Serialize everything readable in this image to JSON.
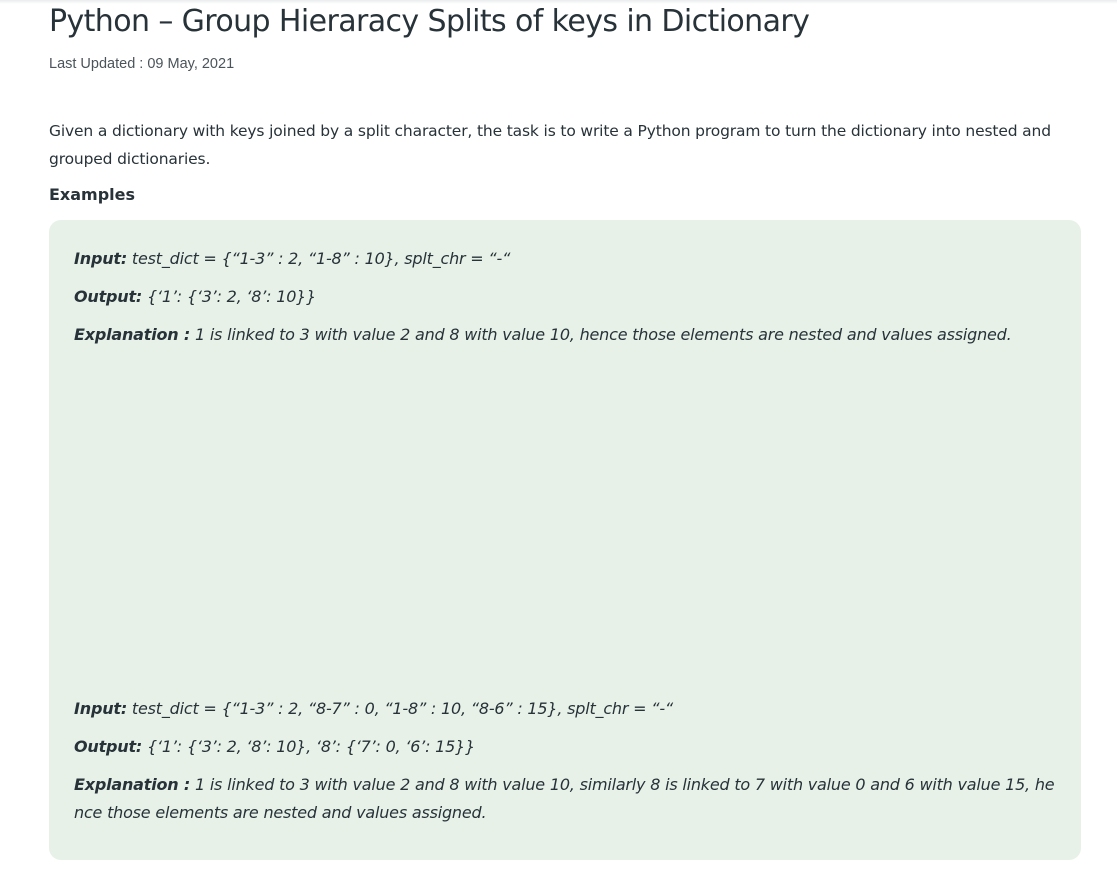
{
  "article": {
    "title": "Python – Group Hieraracy Splits of keys in Dictionary",
    "last_updated": "Last Updated : 09 May, 2021",
    "intro": "Given a dictionary with keys joined by a split character, the task is to write a Python program to turn the dictionary into nested and grouped dictionaries.",
    "examples_heading": "Examples"
  },
  "examples": [
    {
      "input_label": "Input:",
      "input_value": " test_dict = {“1-3” : 2, “1-8” : 10}, splt_chr = “-“",
      "output_label": "Output:",
      "output_value": " {‘1’: {‘3’: 2, ‘8’: 10}}",
      "explanation_label": "Explanation :",
      "explanation_value": " 1 is linked to 3 with value 2 and 8 with value 10, hence those elements are nested and values assigned."
    },
    {
      "input_label": "Input:",
      "input_value": " test_dict = {“1-3” : 2, “8-7” : 0, “1-8” : 10, “8-6” : 15}, splt_chr = “-“",
      "output_label": "Output:",
      "output_value": " {‘1’: {‘3’: 2, ‘8’: 10}, ‘8’: {‘7’: 0, ‘6’: 15}}",
      "explanation_label": "Explanation :",
      "explanation_value": " 1 is linked to 3 with value 2 and 8 with value 10, similarly 8 is linked to 7 with value 0 and 6 with value 15, hence those elements are nested and values assigned."
    }
  ]
}
